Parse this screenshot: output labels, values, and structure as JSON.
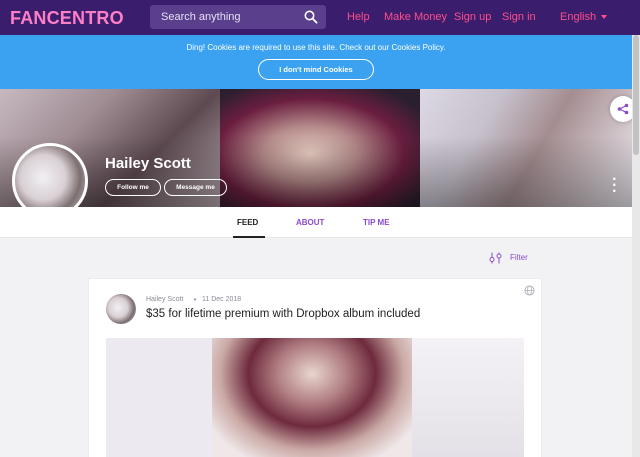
{
  "header": {
    "logo_text": "FANCENTRO",
    "search_placeholder": "Search anything",
    "nav": [
      "Help",
      "Make Money",
      "Sign up",
      "Sign in"
    ],
    "language": "English"
  },
  "cookie_bar": {
    "message": "Ding! Cookies are required to use this site. Check out our Cookies Policy.",
    "button_label": "I don't mind Cookies"
  },
  "profile": {
    "name": "Hailey Scott",
    "follow_label": "Follow me",
    "message_label": "Message me"
  },
  "tabs": [
    "FEED",
    "ABOUT",
    "TIP ME"
  ],
  "active_tab": "FEED",
  "filter_label": "Filter",
  "post": {
    "author": "Hailey Scott",
    "separator": "•",
    "date": "11 Dec 2018",
    "title": "$35 for lifetime premium with Dropbox album included"
  },
  "colors": {
    "nav_bg": "#3b1d6e",
    "accent_pink": "#ff4e8a",
    "cookie_blue": "#3aa2f0",
    "tab_purple": "#8a4bd0"
  },
  "icons": [
    "search-icon",
    "chevron-down-icon",
    "share-icon",
    "more-vertical-icon",
    "filter-icon",
    "globe-icon"
  ]
}
